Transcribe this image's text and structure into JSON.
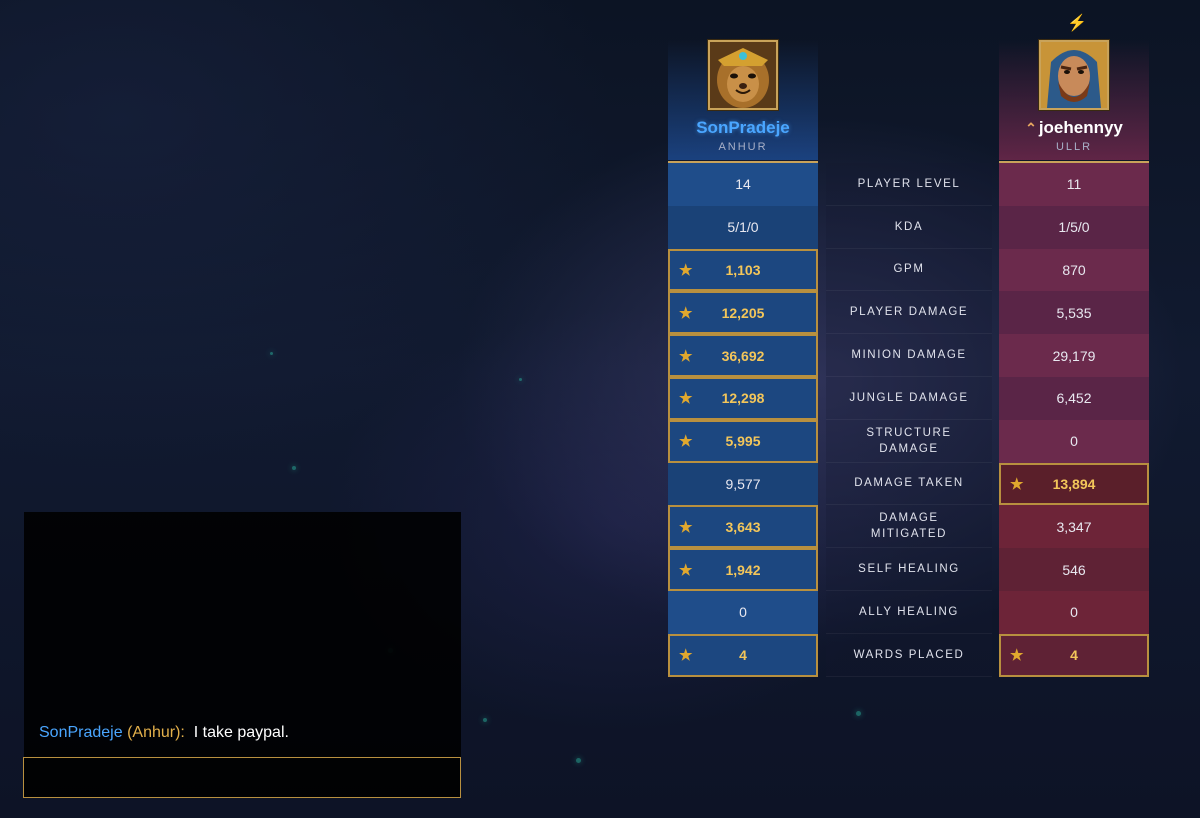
{
  "players": {
    "left": {
      "name": "SonPradeje",
      "god": "ANHUR",
      "team_color": "#4aa6ff"
    },
    "right": {
      "name": "joehennyy",
      "god": "ULLR",
      "team_color": "#b0406a",
      "rank_icon": "chevron-up-icon"
    }
  },
  "header_icon": "lightning-icon",
  "stats": [
    {
      "label": "PLAYER LEVEL",
      "left": "14",
      "right": "11",
      "left_best": false,
      "right_best": false
    },
    {
      "label": "KDA",
      "left": "5/1/0",
      "right": "1/5/0",
      "left_best": false,
      "right_best": false
    },
    {
      "label": "GPM",
      "left": "1,103",
      "right": "870",
      "left_best": true,
      "right_best": false
    },
    {
      "label": "PLAYER DAMAGE",
      "left": "12,205",
      "right": "5,535",
      "left_best": true,
      "right_best": false
    },
    {
      "label": "MINION DAMAGE",
      "left": "36,692",
      "right": "29,179",
      "left_best": true,
      "right_best": false
    },
    {
      "label": "JUNGLE DAMAGE",
      "left": "12,298",
      "right": "6,452",
      "left_best": true,
      "right_best": false
    },
    {
      "label": "STRUCTURE DAMAGE",
      "left": "5,995",
      "right": "0",
      "left_best": true,
      "right_best": false
    },
    {
      "label": "DAMAGE TAKEN",
      "left": "9,577",
      "right": "13,894",
      "left_best": false,
      "right_best": true
    },
    {
      "label": "DAMAGE MITIGATED",
      "left": "3,643",
      "right": "3,347",
      "left_best": true,
      "right_best": false
    },
    {
      "label": "SELF HEALING",
      "left": "1,942",
      "right": "546",
      "left_best": true,
      "right_best": false
    },
    {
      "label": "ALLY HEALING",
      "left": "0",
      "right": "0",
      "left_best": false,
      "right_best": false
    },
    {
      "label": "WARDS PLACED",
      "left": "4",
      "right": "4",
      "left_best": true,
      "right_best": true
    }
  ],
  "best_icon": "star-icon",
  "chat": {
    "sender": "SonPradeje",
    "god": "(Anhur):",
    "message": "I take paypal.",
    "input_value": ""
  }
}
